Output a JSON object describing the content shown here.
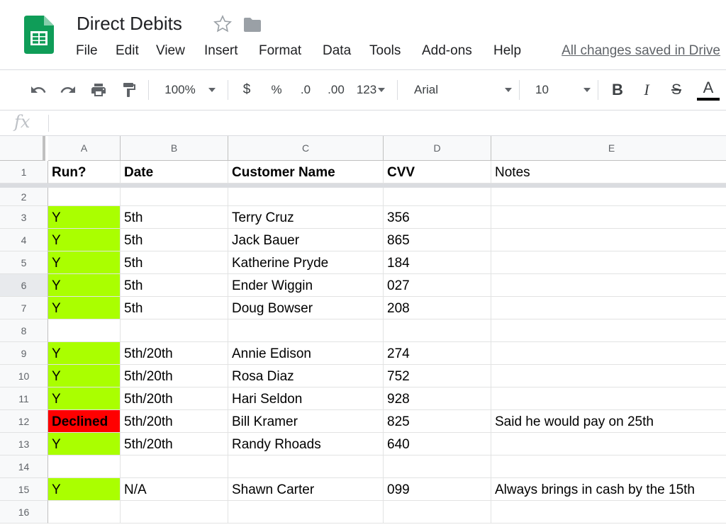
{
  "app": {
    "title": "Direct Debits",
    "logo_icon": "sheets-logo-icon",
    "save_status": "All changes saved in Drive"
  },
  "menu": [
    "File",
    "Edit",
    "View",
    "Insert",
    "Format",
    "Data",
    "Tools",
    "Add-ons",
    "Help"
  ],
  "toolbar": {
    "zoom": "100%",
    "currency": "$",
    "percent": "%",
    "decrease_decimal": ".0",
    "increase_decimal": ".00",
    "more_formats": "123",
    "font": "Arial",
    "font_size": "10",
    "bold": "B",
    "italic": "I",
    "strikethrough": "S",
    "text_color": "A"
  },
  "formula_bar": {
    "fx": "fx",
    "value": ""
  },
  "columns": [
    "A",
    "B",
    "C",
    "D",
    "E"
  ],
  "rows": [
    {
      "num": "1",
      "cells": [
        "Run?",
        "Date",
        "Customer Name",
        "CVV",
        "Notes"
      ]
    },
    {
      "num": "2",
      "cells": [
        "",
        "",
        "",
        "",
        ""
      ]
    },
    {
      "num": "3",
      "cells": [
        "Y",
        "5th",
        "Terry Cruz",
        "356",
        ""
      ]
    },
    {
      "num": "4",
      "cells": [
        "Y",
        "5th",
        "Jack Bauer",
        "865",
        ""
      ]
    },
    {
      "num": "5",
      "cells": [
        "Y",
        "5th",
        "Katherine Pryde",
        "184",
        ""
      ]
    },
    {
      "num": "6",
      "cells": [
        "Y",
        "5th",
        "Ender Wiggin",
        "027",
        ""
      ]
    },
    {
      "num": "7",
      "cells": [
        "Y",
        "5th",
        "Doug Bowser",
        "208",
        ""
      ]
    },
    {
      "num": "8",
      "cells": [
        "",
        "",
        "",
        "",
        ""
      ]
    },
    {
      "num": "9",
      "cells": [
        "Y",
        "5th/20th",
        "Annie Edison",
        "274",
        ""
      ]
    },
    {
      "num": "10",
      "cells": [
        "Y",
        "5th/20th",
        "Rosa Diaz",
        "752",
        ""
      ]
    },
    {
      "num": "11",
      "cells": [
        "Y",
        "5th/20th",
        "Hari Seldon",
        "928",
        ""
      ]
    },
    {
      "num": "12",
      "cells": [
        "Declined",
        "5th/20th",
        "Bill Kramer",
        "825",
        "Said he would pay on 25th"
      ]
    },
    {
      "num": "13",
      "cells": [
        "Y",
        "5th/20th",
        "Randy Rhoads",
        "640",
        ""
      ]
    },
    {
      "num": "14",
      "cells": [
        "",
        "",
        "",
        "",
        ""
      ]
    },
    {
      "num": "15",
      "cells": [
        "Y",
        "N/A",
        "Shawn Carter",
        "099",
        "Always brings in cash by the 15th"
      ]
    },
    {
      "num": "16",
      "cells": [
        "",
        "",
        "",
        "",
        ""
      ]
    }
  ],
  "colors": {
    "run_yes": "#aaff00",
    "run_declined": "#ff0000",
    "sheets_green": "#0f9d58"
  }
}
